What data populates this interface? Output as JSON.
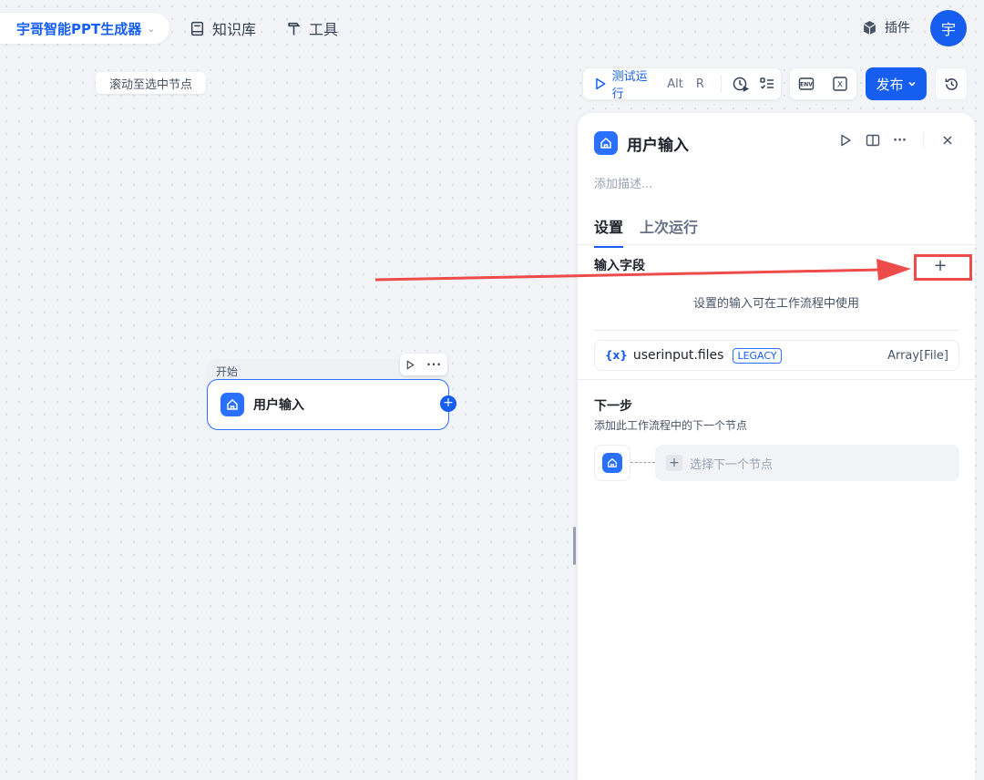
{
  "header": {
    "app_name": "宇哥智能PPT生成器",
    "knowledge_label": "知识库",
    "tools_label": "工具",
    "plugins_label": "插件",
    "avatar_text": "宇"
  },
  "canvas": {
    "scroll_to_selected": "滚动至选中节点",
    "node": {
      "group_label": "开始",
      "title": "用户输入"
    }
  },
  "toolbar": {
    "test_run_label": "测试运行",
    "shortcut_alt": "Alt",
    "shortcut_key": "R",
    "publish_label": "发布",
    "env_icon_label": "ENV",
    "var_icon_label": "X"
  },
  "panel": {
    "title": "用户输入",
    "description_placeholder": "添加描述...",
    "tabs": [
      {
        "label": "设置",
        "active": true
      },
      {
        "label": "上次运行",
        "active": false
      }
    ],
    "input_fields_label": "输入字段",
    "add_field_symbol": "+",
    "input_hint": "设置的输入可在工作流程中使用",
    "variable": {
      "prefix": "{x}",
      "name": "userinput.files",
      "badge": "LEGACY",
      "type": "Array[File]"
    },
    "next_step_title": "下一步",
    "next_step_desc": "添加此工作流程中的下一个节点",
    "select_next_label": "选择下一个节点"
  },
  "colors": {
    "accent": "#155eef",
    "annotation_red": "#ee4b4b"
  }
}
